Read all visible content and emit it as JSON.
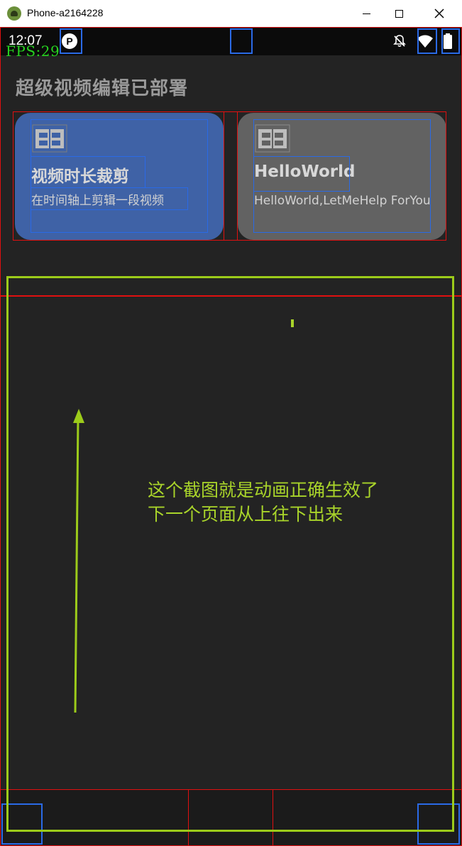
{
  "window": {
    "title": "Phone-a2164228"
  },
  "status_bar": {
    "time": "12:07",
    "fps": "FPS:29"
  },
  "page": {
    "heading": "超级视频编辑已部署"
  },
  "cards": [
    {
      "title": "视频时长裁剪",
      "description": "在时间轴上剪辑一段视频",
      "color": "#3f62a6",
      "icon": "film-icon"
    },
    {
      "title": "HelloWorld",
      "description": "HelloWorld,LetMeHelp ForYou",
      "color": "#626262",
      "icon": "film-icon"
    }
  ],
  "annotation": {
    "line1": "这个截图就是动画正确生效了",
    "line2": "下一个页面从上往下出来",
    "color": "#9ccb1a"
  }
}
